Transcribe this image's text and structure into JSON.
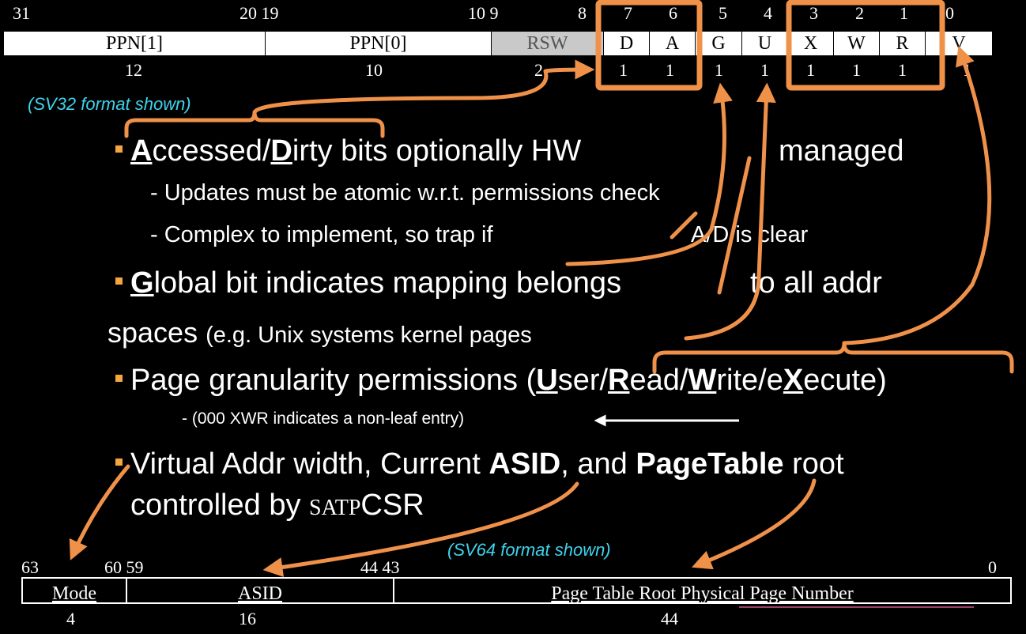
{
  "pte": {
    "bit_numbers": [
      "31",
      "20 19",
      "10 9",
      "8",
      "7",
      "6",
      "5",
      "4",
      "3",
      "2",
      "1",
      "0"
    ],
    "fields": [
      "PPN[1]",
      "PPN[0]",
      "RSW",
      "D",
      "A",
      "G",
      "U",
      "X",
      "W",
      "R",
      "V"
    ],
    "widths": [
      "12",
      "10",
      "2",
      "1",
      "1",
      "1",
      "1",
      "1",
      "1",
      "1",
      "1"
    ],
    "caption": "(SV32 format shown)"
  },
  "bullets": {
    "b1_a": "A",
    "b1_mid": "ccessed/",
    "b1_d": "D",
    "b1_rest": "irty bits optionally HW",
    "b1_managed": "managed",
    "s1": "- Updates must be atomic w.r.t. permissions check",
    "s2_pre": "- Complex to implement, so trap if",
    "s2_post": "A/D is clear",
    "b2_g": "G",
    "b2_rest": "lobal bit indicates mapping belongs",
    "b2_end": "to all addr",
    "b2_line2a": "spaces",
    "b2_line2b": "(e.g. Unix systems kernel pages",
    "b3_pre": "Page granularity permissions (",
    "b3_u": "U",
    "b3_ser": "ser/",
    "b3_r": "R",
    "b3_ead": "ead/",
    "b3_w": "W",
    "b3_rite": "rite/e",
    "b3_x": "X",
    "b3_ecute": "ecute)",
    "s3": "-   (000 XWR indicates a non-leaf entry)",
    "b4_pre": "Virtual Addr width, Current",
    "b4_asid": "ASID",
    "b4_mid": ", and",
    "b4_pt": "PageTable",
    "b4_end": "root",
    "b4_line2": "controlled by",
    "b4_satp": "SATP",
    "b4_csr": "CSR"
  },
  "satp": {
    "bit_numbers": [
      "63",
      "60 59",
      "44 43",
      "0"
    ],
    "fields": [
      "Mode",
      "ASID",
      "Page Table Root Physical Page Number"
    ],
    "widths": [
      "4",
      "16",
      "44"
    ],
    "caption": "(SV64 format shown)"
  },
  "colors": {
    "accent": "#f0914a",
    "caption": "#3fd3ec",
    "bullet": "#f4a640"
  }
}
